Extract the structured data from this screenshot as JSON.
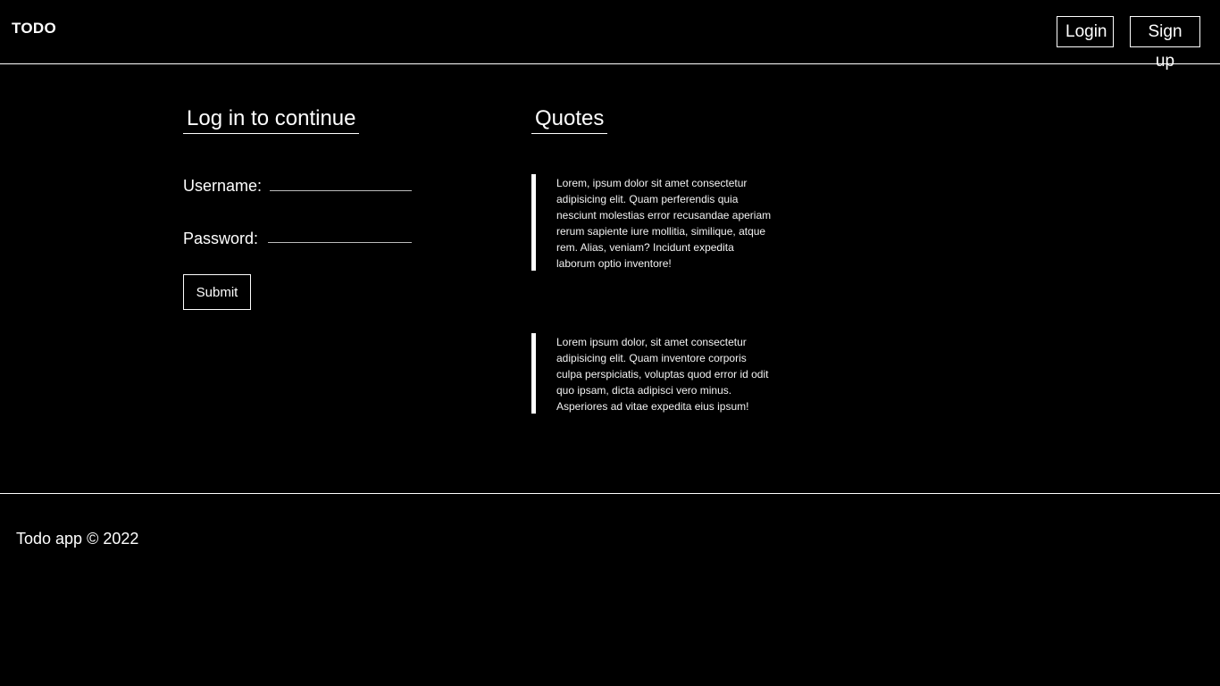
{
  "header": {
    "brand": "TODO",
    "nav": {
      "login_label": "Login",
      "signup_label": "Sign up"
    }
  },
  "login": {
    "title": "Log in to continue",
    "username_label": "Username:",
    "username_value": "",
    "password_label": "Password:",
    "password_value": "",
    "submit_label": "Submit"
  },
  "quotes": {
    "title": "Quotes",
    "items": [
      {
        "text": "Lorem, ipsum dolor sit amet consectetur adipisicing elit. Quam perferendis quia nesciunt molestias error recusandae aperiam rerum sapiente iure mollitia, similique, atque rem. Alias, veniam? Incidunt expedita laborum optio inventore!"
      },
      {
        "text": "Lorem ipsum dolor, sit amet consectetur adipisicing elit. Quam inventore corporis culpa perspiciatis, voluptas quod error id odit quo ipsam, dicta adipisci vero minus. Asperiores ad vitae expedita eius ipsum!"
      }
    ]
  },
  "footer": {
    "text": "Todo app © 2022"
  },
  "colors": {
    "background": "#000000",
    "foreground": "#ffffff"
  }
}
